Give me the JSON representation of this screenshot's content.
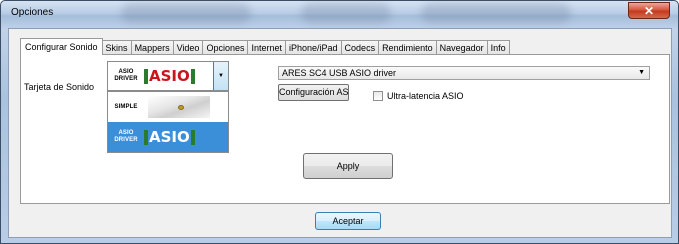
{
  "window": {
    "title": "Opciones",
    "close_glyph": "✕"
  },
  "tabs": [
    {
      "label": "Configurar Sonido",
      "active": true
    },
    {
      "label": "Skins"
    },
    {
      "label": "Mappers"
    },
    {
      "label": "Video"
    },
    {
      "label": "Opciones"
    },
    {
      "label": "Internet"
    },
    {
      "label": "iPhone/iPad"
    },
    {
      "label": "Codecs"
    },
    {
      "label": "Rendimiento"
    },
    {
      "label": "Navegador"
    },
    {
      "label": "Info"
    }
  ],
  "sound": {
    "card_label": "Tarjeta de Sonido",
    "combo_selected": {
      "line1": "ASIO",
      "line2": "DRIVER",
      "logo": "ASIO"
    },
    "dropdown_items": [
      {
        "line1": "SIMPLE",
        "line2": "",
        "logo": ""
      },
      {
        "line1": "ASIO",
        "line2": "DRIVER",
        "logo": "ASIO",
        "selected": true
      }
    ],
    "driver_value": "ARES SC4 USB ASIO driver",
    "config_button": "Configuración ASIO",
    "ultra_latency_label": "Ultra-latencia ASIO",
    "ultra_latency_checked": false,
    "apply_button": "Apply"
  },
  "footer": {
    "accept_button": "Aceptar"
  },
  "colors": {
    "selection": "#3b8ed8",
    "asio_red": "#c8161d",
    "asio_green": "#2a7b2e"
  }
}
